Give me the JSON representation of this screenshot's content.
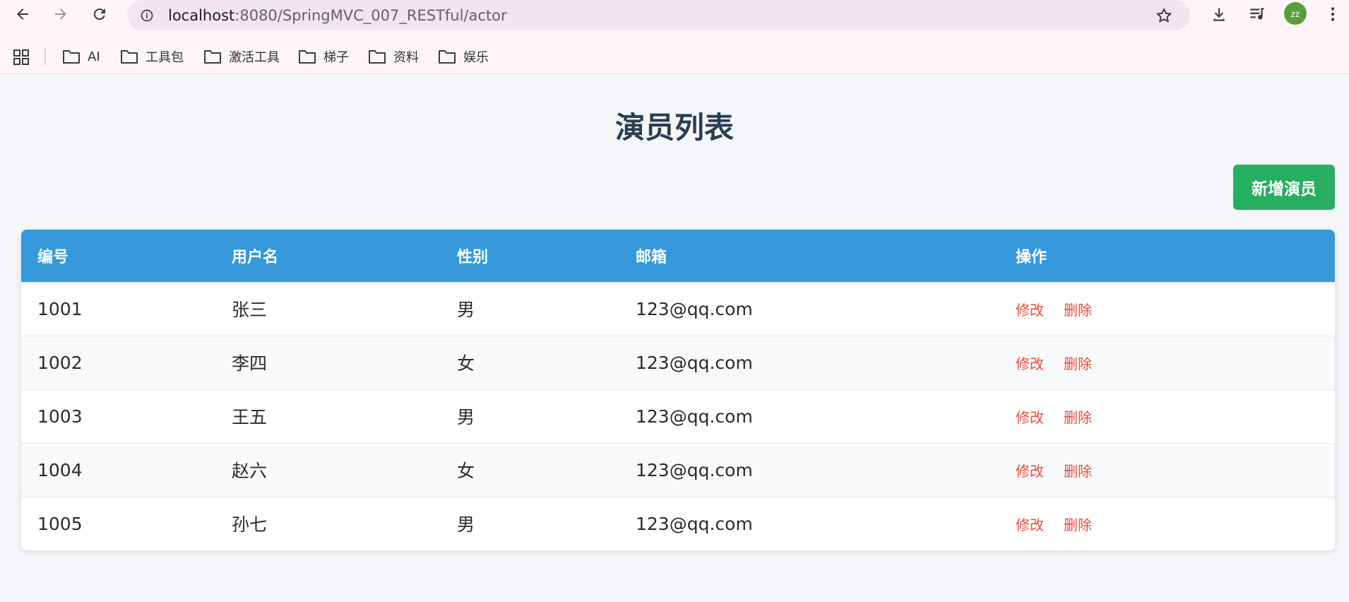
{
  "browser": {
    "url_host": "localhost",
    "url_path": ":8080/SpringMVC_007_RESTful/actor",
    "avatar_text": "zz",
    "bookmarks": [
      {
        "label": "AI"
      },
      {
        "label": "工具包"
      },
      {
        "label": "激活工具"
      },
      {
        "label": "梯子"
      },
      {
        "label": "资料"
      },
      {
        "label": "娱乐"
      }
    ]
  },
  "page": {
    "title": "演员列表",
    "add_button": "新增演员"
  },
  "table": {
    "headers": [
      "编号",
      "用户名",
      "性别",
      "邮箱",
      "操作"
    ],
    "rows": [
      {
        "id": "1001",
        "name": "张三",
        "gender": "男",
        "email": "123@qq.com",
        "edit": "修改",
        "delete": "删除"
      },
      {
        "id": "1002",
        "name": "李四",
        "gender": "女",
        "email": "123@qq.com",
        "edit": "修改",
        "delete": "删除"
      },
      {
        "id": "1003",
        "name": "王五",
        "gender": "男",
        "email": "123@qq.com",
        "edit": "修改",
        "delete": "删除"
      },
      {
        "id": "1004",
        "name": "赵六",
        "gender": "女",
        "email": "123@qq.com",
        "edit": "修改",
        "delete": "删除"
      },
      {
        "id": "1005",
        "name": "孙七",
        "gender": "男",
        "email": "123@qq.com",
        "edit": "修改",
        "delete": "删除"
      }
    ]
  },
  "colors": {
    "header_bg": "#3498db",
    "add_button": "#27ae60",
    "action_link": "#e74c3c",
    "title": "#2c3e50"
  }
}
